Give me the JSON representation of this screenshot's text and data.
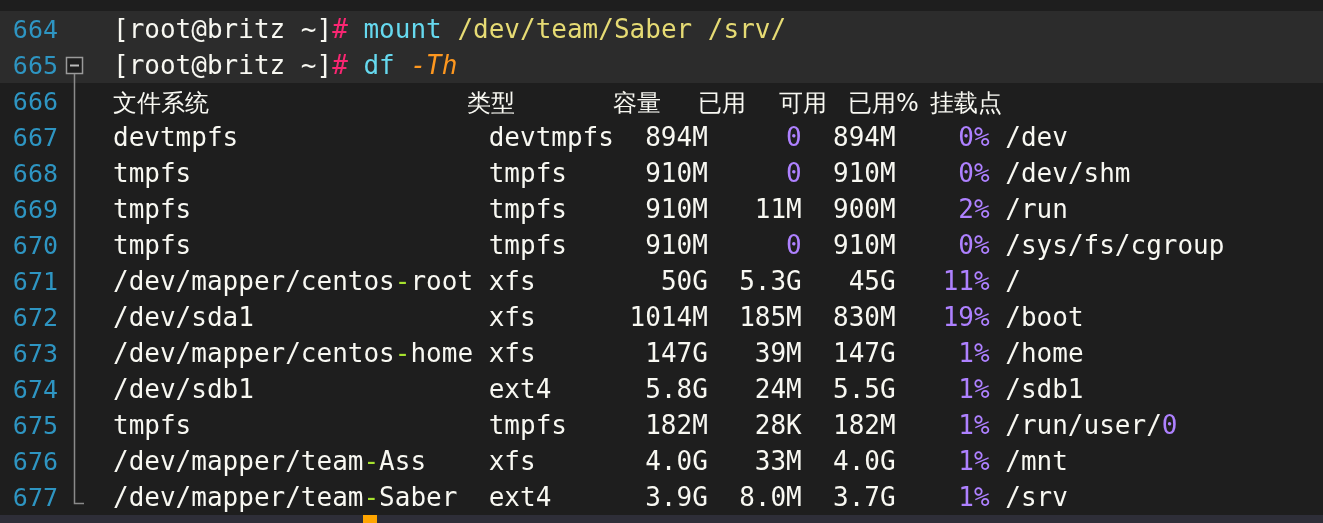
{
  "editor": {
    "lines": [
      {
        "number": "664",
        "highlighted": true,
        "segments": [
          {
            "kind": "text",
            "text": "[root@britz ~]"
          },
          {
            "kind": "prompt",
            "text": "#"
          },
          {
            "kind": "command",
            "text": " mount"
          },
          {
            "kind": "argument",
            "text": " /dev/team/Saber /srv/"
          }
        ]
      },
      {
        "number": "665",
        "highlighted": true,
        "expanded": true,
        "segments": [
          {
            "kind": "text",
            "text": "[root@britz ~]"
          },
          {
            "kind": "prompt",
            "text": "#"
          },
          {
            "kind": "command",
            "text": " df"
          },
          {
            "kind": "flag",
            "text": " -Th"
          }
        ]
      },
      {
        "number": "666",
        "highlighted": false,
        "header": [
          "文件系统",
          "类型",
          "容量",
          "已用",
          "可用",
          "已用%",
          "挂载点"
        ]
      },
      {
        "number": "667",
        "highlighted": false,
        "segments": [
          {
            "kind": "text",
            "text": "devtmpfs                devtmpfs  894M     "
          },
          {
            "kind": "number",
            "text": "0"
          },
          {
            "kind": "text",
            "text": "  894M    "
          },
          {
            "kind": "number",
            "text": "0%"
          },
          {
            "kind": "text",
            "text": " /dev"
          }
        ]
      },
      {
        "number": "668",
        "highlighted": false,
        "segments": [
          {
            "kind": "text",
            "text": "tmpfs                   tmpfs     910M     "
          },
          {
            "kind": "number",
            "text": "0"
          },
          {
            "kind": "text",
            "text": "  910M    "
          },
          {
            "kind": "number",
            "text": "0%"
          },
          {
            "kind": "text",
            "text": " /dev/shm"
          }
        ]
      },
      {
        "number": "669",
        "highlighted": false,
        "segments": [
          {
            "kind": "text",
            "text": "tmpfs                   tmpfs     910M   11M  900M    "
          },
          {
            "kind": "number",
            "text": "2%"
          },
          {
            "kind": "text",
            "text": " /run"
          }
        ]
      },
      {
        "number": "670",
        "highlighted": false,
        "segments": [
          {
            "kind": "text",
            "text": "tmpfs                   tmpfs     910M     "
          },
          {
            "kind": "number",
            "text": "0"
          },
          {
            "kind": "text",
            "text": "  910M    "
          },
          {
            "kind": "number",
            "text": "0%"
          },
          {
            "kind": "text",
            "text": " /sys/fs/cgroup"
          }
        ]
      },
      {
        "number": "671",
        "highlighted": false,
        "segments": [
          {
            "kind": "text",
            "text": "/dev/mapper/centos"
          },
          {
            "kind": "dash",
            "text": "-"
          },
          {
            "kind": "text",
            "text": "root xfs        50G  5.3G   45G   "
          },
          {
            "kind": "number",
            "text": "11%"
          },
          {
            "kind": "text",
            "text": " /"
          }
        ]
      },
      {
        "number": "672",
        "highlighted": false,
        "segments": [
          {
            "kind": "text",
            "text": "/dev/sda1               xfs      1014M  185M  830M   "
          },
          {
            "kind": "number",
            "text": "19%"
          },
          {
            "kind": "text",
            "text": " /boot"
          }
        ]
      },
      {
        "number": "673",
        "highlighted": false,
        "segments": [
          {
            "kind": "text",
            "text": "/dev/mapper/centos"
          },
          {
            "kind": "dash",
            "text": "-"
          },
          {
            "kind": "text",
            "text": "home xfs       147G   39M  147G    "
          },
          {
            "kind": "number",
            "text": "1%"
          },
          {
            "kind": "text",
            "text": " /home"
          }
        ]
      },
      {
        "number": "674",
        "highlighted": false,
        "segments": [
          {
            "kind": "text",
            "text": "/dev/sdb1               ext4      5.8G   24M  5.5G    "
          },
          {
            "kind": "number",
            "text": "1%"
          },
          {
            "kind": "text",
            "text": " /sdb1"
          }
        ]
      },
      {
        "number": "675",
        "highlighted": false,
        "segments": [
          {
            "kind": "text",
            "text": "tmpfs                   tmpfs     182M   28K  182M    "
          },
          {
            "kind": "number",
            "text": "1%"
          },
          {
            "kind": "text",
            "text": " /run/user/"
          },
          {
            "kind": "number",
            "text": "0"
          }
        ]
      },
      {
        "number": "676",
        "highlighted": false,
        "segments": [
          {
            "kind": "text",
            "text": "/dev/mapper/team"
          },
          {
            "kind": "dash",
            "text": "-"
          },
          {
            "kind": "text",
            "text": "Ass    xfs       4.0G   33M  4.0G    "
          },
          {
            "kind": "number",
            "text": "1%"
          },
          {
            "kind": "text",
            "text": " /mnt"
          }
        ]
      },
      {
        "number": "677",
        "highlighted": false,
        "segments": [
          {
            "kind": "text",
            "text": "/dev/mapper/team"
          },
          {
            "kind": "dash",
            "text": "-"
          },
          {
            "kind": "text",
            "text": "Saber  ext4      3.9G  8.0M  3.7G    "
          },
          {
            "kind": "number",
            "text": "1%"
          },
          {
            "kind": "text",
            "text": " /srv"
          }
        ]
      }
    ]
  }
}
